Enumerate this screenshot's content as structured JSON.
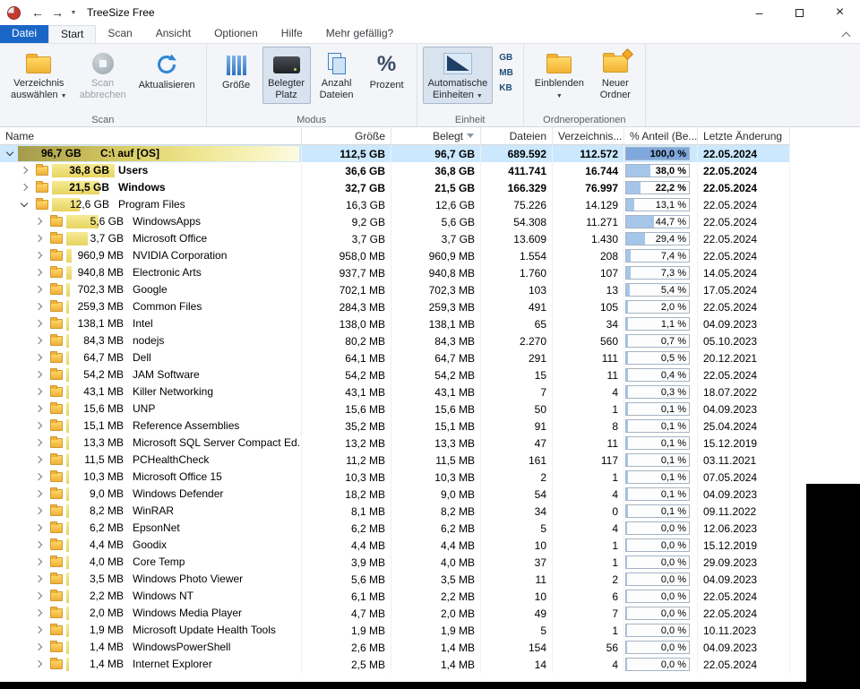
{
  "window": {
    "title": "TreeSize Free"
  },
  "icons": {
    "back_glyph": "←",
    "forward_glyph": "→",
    "caret_glyph": "▼",
    "minimize_glyph": "–",
    "close_glyph": "×",
    "percent_glyph": "%"
  },
  "tabs": [
    {
      "id": "datei",
      "label": "Datei",
      "style": "file"
    },
    {
      "id": "start",
      "label": "Start",
      "style": "active"
    },
    {
      "id": "scan",
      "label": "Scan",
      "style": ""
    },
    {
      "id": "ansicht",
      "label": "Ansicht",
      "style": ""
    },
    {
      "id": "optionen",
      "label": "Optionen",
      "style": ""
    },
    {
      "id": "hilfe",
      "label": "Hilfe",
      "style": ""
    },
    {
      "id": "mehr",
      "label": "Mehr gefällig?",
      "style": ""
    }
  ],
  "ribbon": {
    "group_labels": {
      "scan": "Scan",
      "modus": "Modus",
      "einheit": "Einheit",
      "ordner": "Ordneroperationen"
    },
    "scan": {
      "select_dir_1": "Verzeichnis",
      "select_dir_2": "auswählen",
      "cancel_1": "Scan",
      "cancel_2": "abbrechen",
      "refresh": "Aktualisieren"
    },
    "modus": {
      "groesse": "Größe",
      "belegt_1": "Belegter",
      "belegt_2": "Platz",
      "anzahl_1": "Anzahl",
      "anzahl_2": "Dateien",
      "prozent": "Prozent"
    },
    "einheit": {
      "auto_1": "Automatische",
      "auto_2": "Einheiten",
      "gb": "GB",
      "mb": "MB",
      "kb": "KB"
    },
    "ordner": {
      "einblenden": "Einblenden",
      "neu_1": "Neuer",
      "neu_2": "Ordner"
    }
  },
  "table": {
    "columns": [
      "Name",
      "Größe",
      "Belegt",
      "Dateien",
      "Verzeichnis...",
      "% Anteil (Be...",
      "Letzte Änderung"
    ],
    "rows": [
      {
        "level": 0,
        "expanded": true,
        "icon": "drive",
        "size": "96,7 GB",
        "name": "C:\\ auf  [OS]",
        "groesse": "112,5 GB",
        "belegt": "96,7 GB",
        "dateien": "689.592",
        "verzeichnisse": "112.572",
        "percent": "100,0 %",
        "pct_value": 100,
        "date": "22.05.2024",
        "bold": true,
        "selected": true
      },
      {
        "level": 1,
        "expanded": false,
        "icon": "folder",
        "size": "36,8 GB",
        "name": "Users",
        "groesse": "36,6 GB",
        "belegt": "36,8 GB",
        "dateien": "411.741",
        "verzeichnisse": "16.744",
        "percent": "38,0 %",
        "pct_value": 38,
        "date": "22.05.2024",
        "bold": true,
        "selected": false
      },
      {
        "level": 1,
        "expanded": false,
        "icon": "folder",
        "size": "21,5 GB",
        "name": "Windows",
        "groesse": "32,7 GB",
        "belegt": "21,5 GB",
        "dateien": "166.329",
        "verzeichnisse": "76.997",
        "percent": "22,2 %",
        "pct_value": 22.2,
        "date": "22.05.2024",
        "bold": true,
        "selected": false
      },
      {
        "level": 1,
        "expanded": true,
        "icon": "folder",
        "size": "12,6 GB",
        "name": "Program Files",
        "groesse": "16,3 GB",
        "belegt": "12,6 GB",
        "dateien": "75.226",
        "verzeichnisse": "14.129",
        "percent": "13,1 %",
        "pct_value": 13.1,
        "date": "22.05.2024",
        "bold": false,
        "selected": false
      },
      {
        "level": 2,
        "expanded": false,
        "icon": "folder",
        "size": "5,6 GB",
        "name": "WindowsApps",
        "groesse": "9,2 GB",
        "belegt": "5,6 GB",
        "dateien": "54.308",
        "verzeichnisse": "11.271",
        "percent": "44,7 %",
        "pct_value": 44.7,
        "date": "22.05.2024",
        "bold": false,
        "selected": false
      },
      {
        "level": 2,
        "expanded": false,
        "icon": "folder",
        "size": "3,7 GB",
        "name": "Microsoft Office",
        "groesse": "3,7 GB",
        "belegt": "3,7 GB",
        "dateien": "13.609",
        "verzeichnisse": "1.430",
        "percent": "29,4 %",
        "pct_value": 29.4,
        "date": "22.05.2024",
        "bold": false,
        "selected": false
      },
      {
        "level": 2,
        "expanded": false,
        "icon": "folder",
        "size": "960,9 MB",
        "name": "NVIDIA Corporation",
        "groesse": "958,0 MB",
        "belegt": "960,9 MB",
        "dateien": "1.554",
        "verzeichnisse": "208",
        "percent": "7,4 %",
        "pct_value": 7.4,
        "date": "22.05.2024",
        "bold": false,
        "selected": false
      },
      {
        "level": 2,
        "expanded": false,
        "icon": "folder",
        "size": "940,8 MB",
        "name": "Electronic Arts",
        "groesse": "937,7 MB",
        "belegt": "940,8 MB",
        "dateien": "1.760",
        "verzeichnisse": "107",
        "percent": "7,3 %",
        "pct_value": 7.3,
        "date": "14.05.2024",
        "bold": false,
        "selected": false
      },
      {
        "level": 2,
        "expanded": false,
        "icon": "folder",
        "size": "702,3 MB",
        "name": "Google",
        "groesse": "702,1 MB",
        "belegt": "702,3 MB",
        "dateien": "103",
        "verzeichnisse": "13",
        "percent": "5,4 %",
        "pct_value": 5.4,
        "date": "17.05.2024",
        "bold": false,
        "selected": false
      },
      {
        "level": 2,
        "expanded": false,
        "icon": "folder",
        "size": "259,3 MB",
        "name": "Common Files",
        "groesse": "284,3 MB",
        "belegt": "259,3 MB",
        "dateien": "491",
        "verzeichnisse": "105",
        "percent": "2,0 %",
        "pct_value": 2,
        "date": "22.05.2024",
        "bold": false,
        "selected": false
      },
      {
        "level": 2,
        "expanded": false,
        "icon": "folder",
        "size": "138,1 MB",
        "name": "Intel",
        "groesse": "138,0 MB",
        "belegt": "138,1 MB",
        "dateien": "65",
        "verzeichnisse": "34",
        "percent": "1,1 %",
        "pct_value": 1.1,
        "date": "04.09.2023",
        "bold": false,
        "selected": false
      },
      {
        "level": 2,
        "expanded": false,
        "icon": "folder",
        "size": "84,3 MB",
        "name": "nodejs",
        "groesse": "80,2 MB",
        "belegt": "84,3 MB",
        "dateien": "2.270",
        "verzeichnisse": "560",
        "percent": "0,7 %",
        "pct_value": 0.7,
        "date": "05.10.2023",
        "bold": false,
        "selected": false
      },
      {
        "level": 2,
        "expanded": false,
        "icon": "folder",
        "size": "64,7 MB",
        "name": "Dell",
        "groesse": "64,1 MB",
        "belegt": "64,7 MB",
        "dateien": "291",
        "verzeichnisse": "111",
        "percent": "0,5 %",
        "pct_value": 0.5,
        "date": "20.12.2021",
        "bold": false,
        "selected": false
      },
      {
        "level": 2,
        "expanded": false,
        "icon": "folder",
        "size": "54,2 MB",
        "name": "JAM Software",
        "groesse": "54,2 MB",
        "belegt": "54,2 MB",
        "dateien": "15",
        "verzeichnisse": "11",
        "percent": "0,4 %",
        "pct_value": 0.4,
        "date": "22.05.2024",
        "bold": false,
        "selected": false
      },
      {
        "level": 2,
        "expanded": false,
        "icon": "folder",
        "size": "43,1 MB",
        "name": "Killer Networking",
        "groesse": "43,1 MB",
        "belegt": "43,1 MB",
        "dateien": "7",
        "verzeichnisse": "4",
        "percent": "0,3 %",
        "pct_value": 0.3,
        "date": "18.07.2022",
        "bold": false,
        "selected": false
      },
      {
        "level": 2,
        "expanded": false,
        "icon": "folder",
        "size": "15,6 MB",
        "name": "UNP",
        "groesse": "15,6 MB",
        "belegt": "15,6 MB",
        "dateien": "50",
        "verzeichnisse": "1",
        "percent": "0,1 %",
        "pct_value": 0.1,
        "date": "04.09.2023",
        "bold": false,
        "selected": false
      },
      {
        "level": 2,
        "expanded": false,
        "icon": "folder",
        "size": "15,1 MB",
        "name": "Reference Assemblies",
        "groesse": "35,2 MB",
        "belegt": "15,1 MB",
        "dateien": "91",
        "verzeichnisse": "8",
        "percent": "0,1 %",
        "pct_value": 0.1,
        "date": "25.04.2024",
        "bold": false,
        "selected": false
      },
      {
        "level": 2,
        "expanded": false,
        "icon": "folder",
        "size": "13,3 MB",
        "name": "Microsoft SQL Server Compact Ed...",
        "groesse": "13,2 MB",
        "belegt": "13,3 MB",
        "dateien": "47",
        "verzeichnisse": "11",
        "percent": "0,1 %",
        "pct_value": 0.1,
        "date": "15.12.2019",
        "bold": false,
        "selected": false
      },
      {
        "level": 2,
        "expanded": false,
        "icon": "folder",
        "size": "11,5 MB",
        "name": "PCHealthCheck",
        "groesse": "11,2 MB",
        "belegt": "11,5 MB",
        "dateien": "161",
        "verzeichnisse": "117",
        "percent": "0,1 %",
        "pct_value": 0.1,
        "date": "03.11.2021",
        "bold": false,
        "selected": false
      },
      {
        "level": 2,
        "expanded": false,
        "icon": "folder",
        "size": "10,3 MB",
        "name": "Microsoft Office 15",
        "groesse": "10,3 MB",
        "belegt": "10,3 MB",
        "dateien": "2",
        "verzeichnisse": "1",
        "percent": "0,1 %",
        "pct_value": 0.1,
        "date": "07.05.2024",
        "bold": false,
        "selected": false
      },
      {
        "level": 2,
        "expanded": false,
        "icon": "folder",
        "size": "9,0 MB",
        "name": "Windows Defender",
        "groesse": "18,2 MB",
        "belegt": "9,0 MB",
        "dateien": "54",
        "verzeichnisse": "4",
        "percent": "0,1 %",
        "pct_value": 0.1,
        "date": "04.09.2023",
        "bold": false,
        "selected": false
      },
      {
        "level": 2,
        "expanded": false,
        "icon": "folder",
        "size": "8,2 MB",
        "name": "WinRAR",
        "groesse": "8,1 MB",
        "belegt": "8,2 MB",
        "dateien": "34",
        "verzeichnisse": "0",
        "percent": "0,1 %",
        "pct_value": 0.1,
        "date": "09.11.2022",
        "bold": false,
        "selected": false
      },
      {
        "level": 2,
        "expanded": false,
        "icon": "folder",
        "size": "6,2 MB",
        "name": "EpsonNet",
        "groesse": "6,2 MB",
        "belegt": "6,2 MB",
        "dateien": "5",
        "verzeichnisse": "4",
        "percent": "0,0 %",
        "pct_value": 0,
        "date": "12.06.2023",
        "bold": false,
        "selected": false
      },
      {
        "level": 2,
        "expanded": false,
        "icon": "folder",
        "size": "4,4 MB",
        "name": "Goodix",
        "groesse": "4,4 MB",
        "belegt": "4,4 MB",
        "dateien": "10",
        "verzeichnisse": "1",
        "percent": "0,0 %",
        "pct_value": 0,
        "date": "15.12.2019",
        "bold": false,
        "selected": false
      },
      {
        "level": 2,
        "expanded": false,
        "icon": "folder",
        "size": "4,0 MB",
        "name": "Core Temp",
        "groesse": "3,9 MB",
        "belegt": "4,0 MB",
        "dateien": "37",
        "verzeichnisse": "1",
        "percent": "0,0 %",
        "pct_value": 0,
        "date": "29.09.2023",
        "bold": false,
        "selected": false
      },
      {
        "level": 2,
        "expanded": false,
        "icon": "folder",
        "size": "3,5 MB",
        "name": "Windows Photo Viewer",
        "groesse": "5,6 MB",
        "belegt": "3,5 MB",
        "dateien": "11",
        "verzeichnisse": "2",
        "percent": "0,0 %",
        "pct_value": 0,
        "date": "04.09.2023",
        "bold": false,
        "selected": false
      },
      {
        "level": 2,
        "expanded": false,
        "icon": "folder",
        "size": "2,2 MB",
        "name": "Windows NT",
        "groesse": "6,1 MB",
        "belegt": "2,2 MB",
        "dateien": "10",
        "verzeichnisse": "6",
        "percent": "0,0 %",
        "pct_value": 0,
        "date": "22.05.2024",
        "bold": false,
        "selected": false
      },
      {
        "level": 2,
        "expanded": false,
        "icon": "folder",
        "size": "2,0 MB",
        "name": "Windows Media Player",
        "groesse": "4,7 MB",
        "belegt": "2,0 MB",
        "dateien": "49",
        "verzeichnisse": "7",
        "percent": "0,0 %",
        "pct_value": 0,
        "date": "22.05.2024",
        "bold": false,
        "selected": false
      },
      {
        "level": 2,
        "expanded": false,
        "icon": "folder",
        "size": "1,9 MB",
        "name": "Microsoft Update Health Tools",
        "groesse": "1,9 MB",
        "belegt": "1,9 MB",
        "dateien": "5",
        "verzeichnisse": "1",
        "percent": "0,0 %",
        "pct_value": 0,
        "date": "10.11.2023",
        "bold": false,
        "selected": false
      },
      {
        "level": 2,
        "expanded": false,
        "icon": "folder",
        "size": "1,4 MB",
        "name": "WindowsPowerShell",
        "groesse": "2,6 MB",
        "belegt": "1,4 MB",
        "dateien": "154",
        "verzeichnisse": "56",
        "percent": "0,0 %",
        "pct_value": 0,
        "date": "04.09.2023",
        "bold": false,
        "selected": false
      },
      {
        "level": 2,
        "expanded": false,
        "icon": "folder",
        "size": "1,4 MB",
        "name": "Internet Explorer",
        "groesse": "2,5 MB",
        "belegt": "1,4 MB",
        "dateien": "14",
        "verzeichnisse": "4",
        "percent": "0,0 %",
        "pct_value": 0,
        "date": "22.05.2024",
        "bold": false,
        "selected": false
      }
    ]
  }
}
